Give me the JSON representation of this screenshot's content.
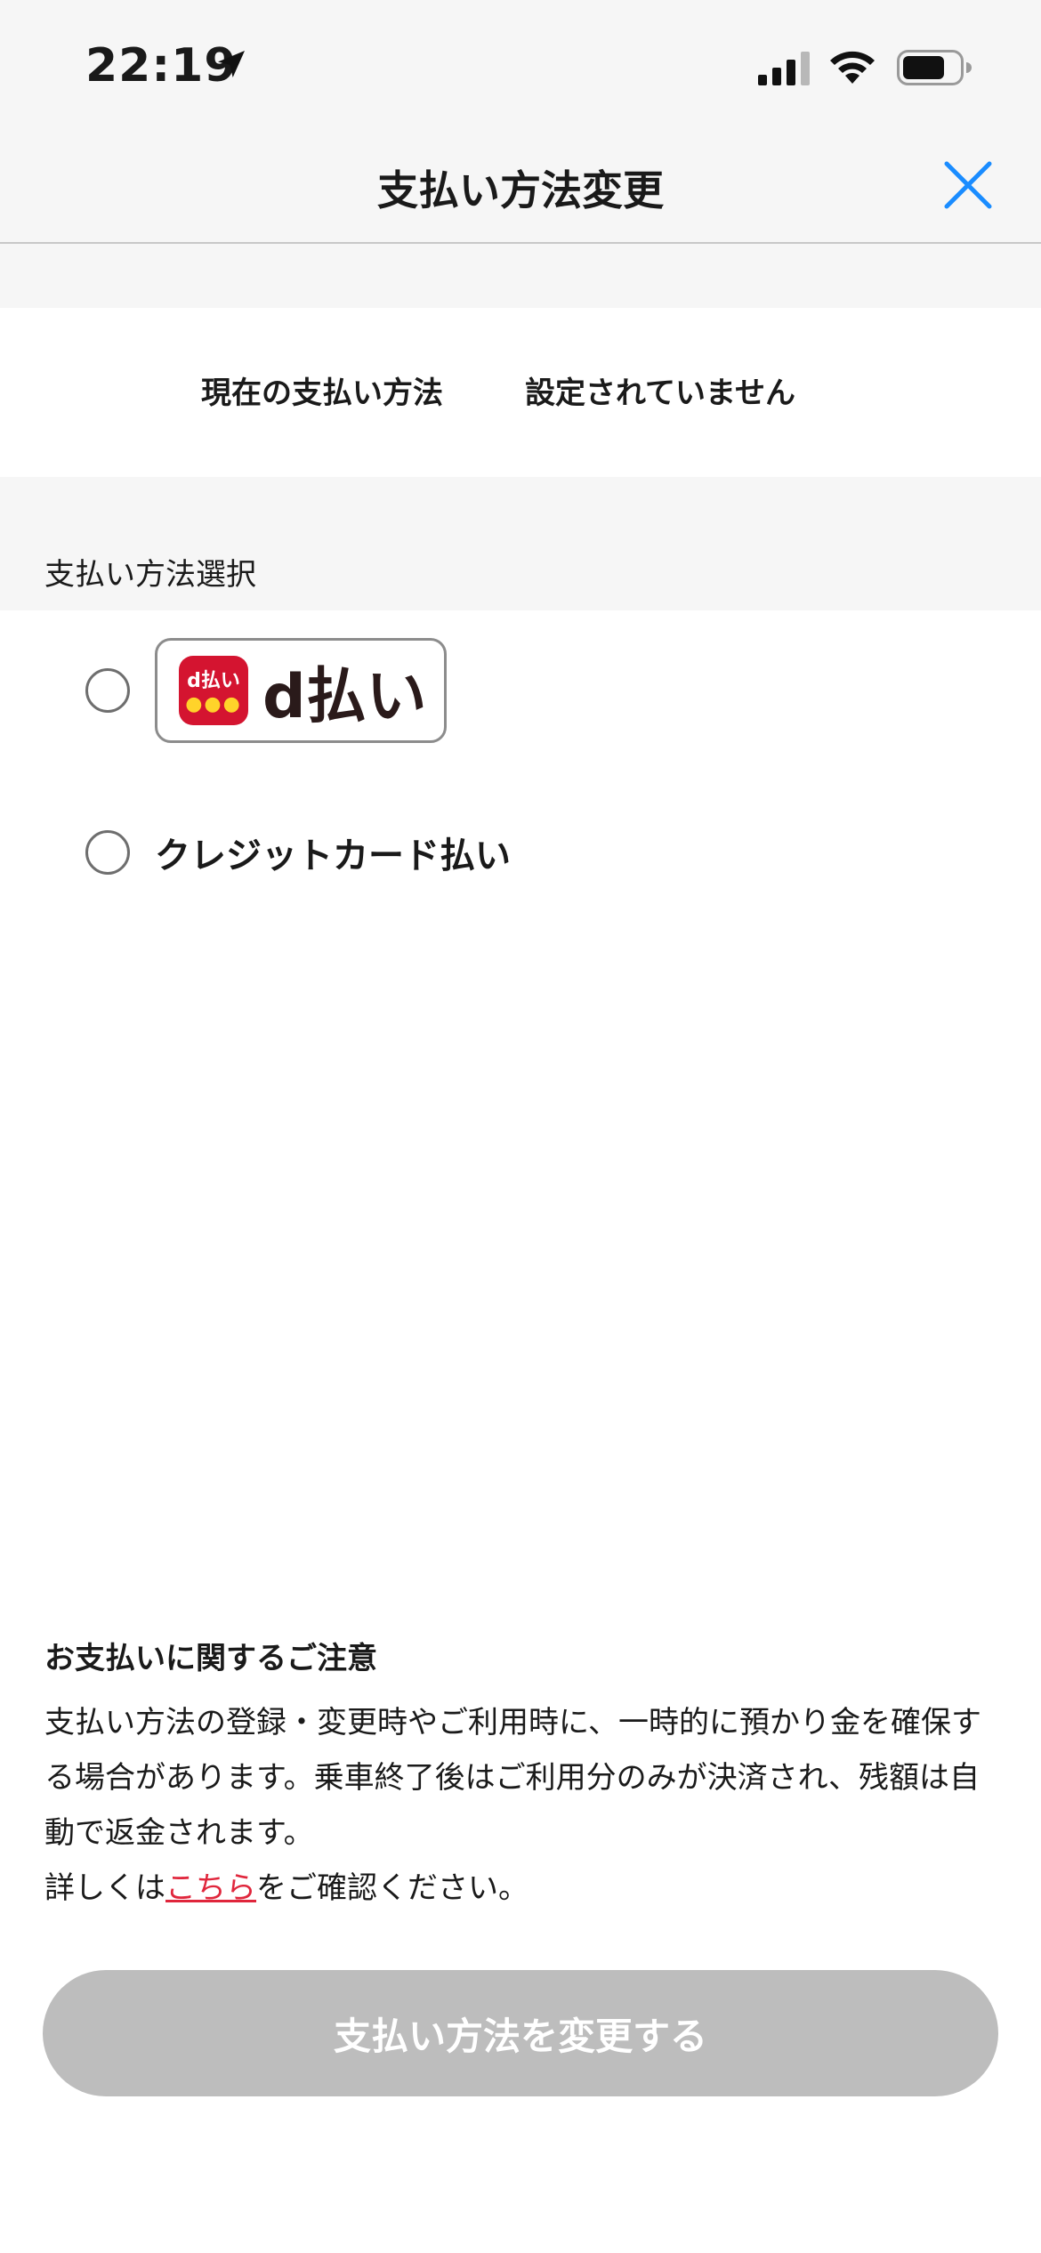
{
  "status_bar": {
    "time": "22:19",
    "icons": [
      "location-arrow-icon",
      "cellular-signal-icon",
      "wifi-icon",
      "battery-icon"
    ]
  },
  "header": {
    "title": "支払い方法変更",
    "close_icon": "close-icon",
    "accent_color": "#1a8cff"
  },
  "current_payment": {
    "label": "現在の支払い方法",
    "value": "設定されていません"
  },
  "selection": {
    "label": "支払い方法選択",
    "options": [
      {
        "id": "dpay",
        "logo_icon_text": "d払い",
        "logo_text": "d払い",
        "selected": false,
        "brand_color": "#d41430"
      },
      {
        "id": "credit",
        "label": "クレジットカード払い",
        "selected": false
      }
    ]
  },
  "notice": {
    "title": "お支払いに関するご注意",
    "body_line1": "支払い方法の登録・変更時やご利用時に、一時的に預かり金を確保する場合があります。乗車終了後はご利用分のみが決済され、残額は自動で返金されます。",
    "link_prefix": "詳しくは",
    "link_text": "こちら",
    "link_suffix": "をご確認ください。",
    "link_color": "#e0263c"
  },
  "submit": {
    "label": "支払い方法を変更する",
    "disabled": true
  }
}
